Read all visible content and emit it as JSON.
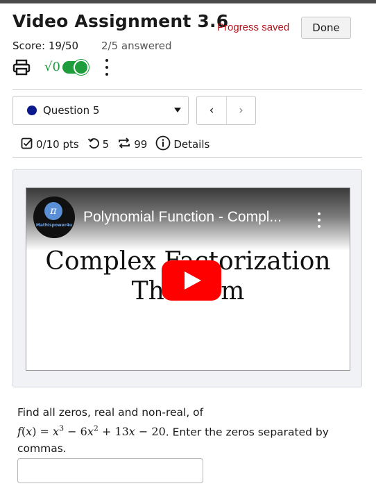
{
  "header": {
    "title": "Video Assignment 3.6",
    "progress_text": "Progress saved",
    "done_label": "Done",
    "score": "Score: 19/50",
    "answered": "2/5 answered",
    "math_toggle_label": "√0"
  },
  "question_nav": {
    "selected": "Question 5",
    "prev_label": "‹",
    "next_label": "›"
  },
  "meta": {
    "points": "0/10 pts",
    "attempts": "5",
    "retries": "99",
    "details_label": "Details"
  },
  "video": {
    "channel_logo_text": "Mathispower4u",
    "title": "Polynomial Function - Compl...",
    "slide_line1": "Complex Factorization",
    "slide_line2": "Theorem"
  },
  "question": {
    "prefix": "Find all zeros, real and non-real, of",
    "suffix": ". Enter the zeros separated by commas."
  },
  "answer": {
    "value": ""
  },
  "colors": {
    "progress": "#b3141c",
    "toggle": "#1f9d3c",
    "question_dot": "#0a1a8c",
    "play_button": "#ff0000"
  }
}
